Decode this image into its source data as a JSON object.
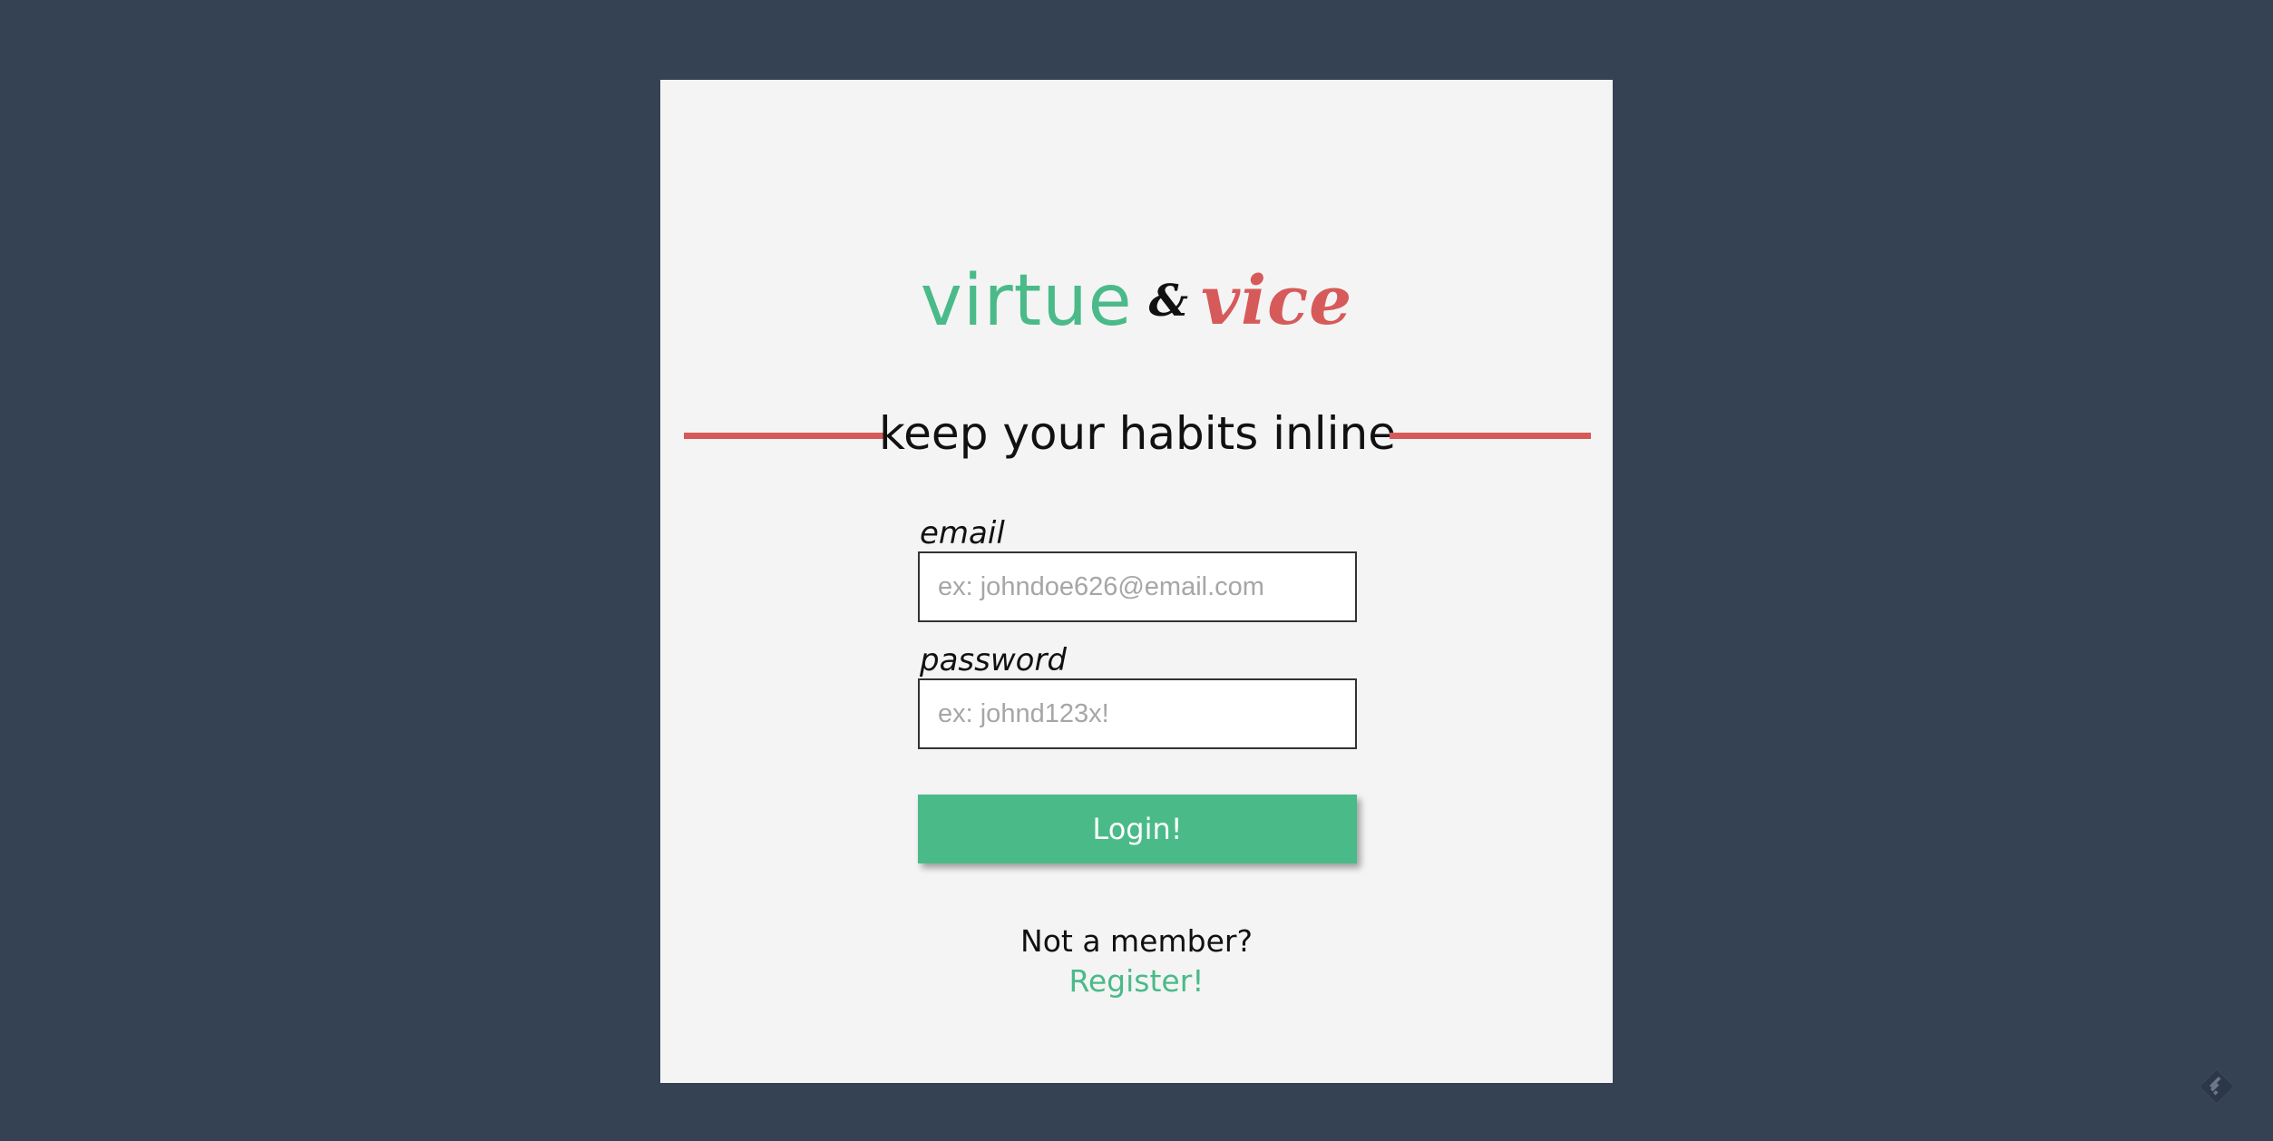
{
  "logo": {
    "virtue": "virtue",
    "ampersand": "&",
    "vice": "vice"
  },
  "tagline": "keep your habits inline",
  "form": {
    "email_label": "email",
    "email_placeholder": "ex: johndoe626@email.com",
    "password_label": "password",
    "password_placeholder": "ex: johnd123x!",
    "login_label": "Login!"
  },
  "footer": {
    "not_member_text": "Not a member?",
    "register_label": "Register!"
  },
  "colors": {
    "background": "#344253",
    "card": "#f4f4f4",
    "accent_green": "#4aba89",
    "accent_red": "#d75a5a"
  },
  "icons": {
    "corner": "feedly-icon"
  }
}
